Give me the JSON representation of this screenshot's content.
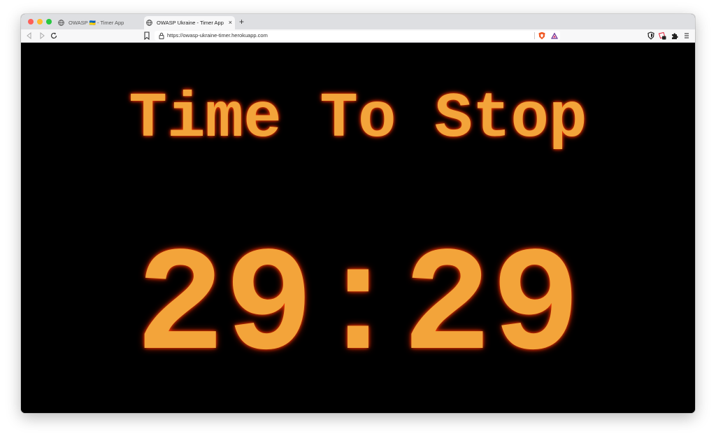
{
  "browser": {
    "tabs": [
      {
        "title": "OWASP 🇺🇦 - Timer App",
        "active": false
      },
      {
        "title": "OWASP Ukraine - Timer App",
        "active": true
      }
    ],
    "close_symbol": "×",
    "new_tab_symbol": "+",
    "url": "https://owasp-ukraine-timer.herokuapp.com",
    "icons": {
      "back": "back-arrow-icon",
      "forward": "forward-arrow-icon",
      "reload": "reload-icon",
      "bookmark": "bookmark-icon",
      "lock": "lock-icon",
      "brave_shield": "brave-shield-icon",
      "rewards": "rewards-triangle-icon",
      "shield": "shield-icon",
      "extension": "extension-icon",
      "puzzle": "puzzle-icon",
      "menu": "menu-icon"
    }
  },
  "page": {
    "heading": "Time To Stop",
    "timer": "29:29"
  },
  "colors": {
    "text": "#f3a43a",
    "glow": "#ff3a00",
    "background": "#000000"
  }
}
